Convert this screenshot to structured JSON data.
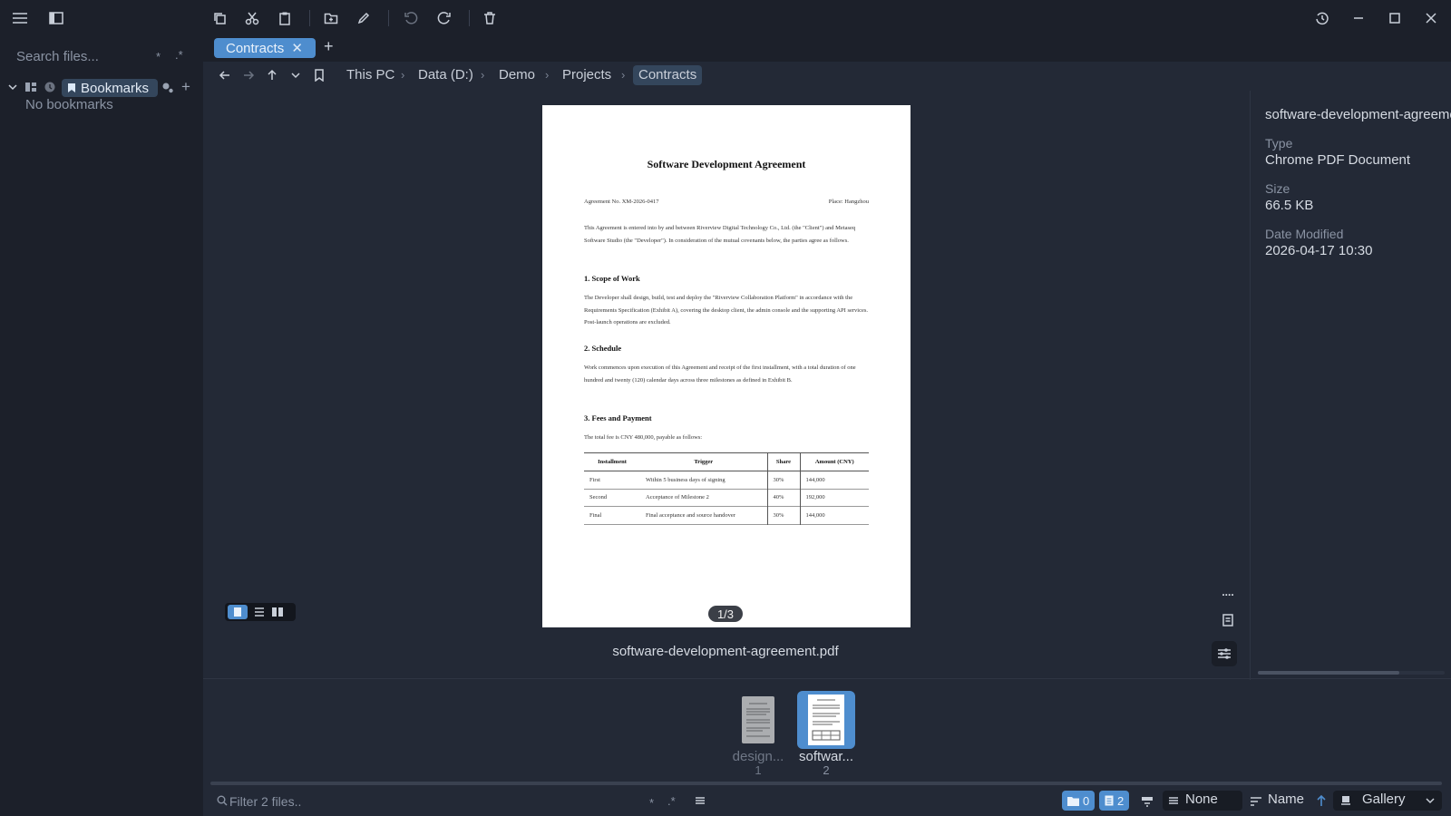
{
  "sidebar": {
    "search_placeholder": "Search files...",
    "search_star": "*",
    "search_regex": ".*",
    "bookmarks_label": "Bookmarks",
    "no_bookmarks": "No bookmarks"
  },
  "tabs": [
    {
      "label": "Contracts",
      "close": "✕"
    }
  ],
  "new_tab": "+",
  "breadcrumb": [
    "This PC",
    "Data (D:)",
    "Demo",
    "Projects",
    "Contracts"
  ],
  "breadcrumb_sep": "›",
  "preview": {
    "page_indicator": "1/3",
    "filename": "software-development-agreement.pdf",
    "more_label": "...."
  },
  "pdf": {
    "title": "Software Development Agreement",
    "agreement_no": "Agreement No. XM-2026-0417",
    "place": "Place: Hangzhou",
    "intro": "This Agreement is entered into by and between Riverview Digital Technology Co., Ltd. (the \"Client\") and Metaseq Software Studio (the \"Developer\"). In consideration of the mutual covenants below, the parties agree as follows.",
    "s1_title": "1. Scope of Work",
    "s1_body": "The Developer shall design, build, test and deploy the \"Riverview Collaboration Platform\" in accordance with the Requirements Specification (Exhibit A), covering the desktop client, the admin console and the supporting API services. Post-launch operations are excluded.",
    "s2_title": "2. Schedule",
    "s2_body": "Work commences upon execution of this Agreement and receipt of the first installment, with a total duration of one hundred and twenty (120) calendar days across three milestones as defined in Exhibit B.",
    "s3_title": "3. Fees and Payment",
    "s3_body": "The total fee is CNY 480,000, payable as follows:",
    "table_headers": [
      "Installment",
      "Trigger",
      "Share",
      "Amount (CNY)"
    ],
    "table_rows": [
      [
        "First",
        "Within 5 business days of signing",
        "30%",
        "144,000"
      ],
      [
        "Second",
        "Acceptance of Milestone 2",
        "40%",
        "192,000"
      ],
      [
        "Final",
        "Final acceptance and source handover",
        "30%",
        "144,000"
      ]
    ]
  },
  "details": {
    "name": "software-development-agreement.pdf",
    "type_label": "Type",
    "type_value": "Chrome PDF Document",
    "size_label": "Size",
    "size_value": "66.5 KB",
    "date_label": "Date Modified",
    "date_value": "2026-04-17 10:30"
  },
  "thumbnails": [
    {
      "label": "design...",
      "index": "1"
    },
    {
      "label": "softwar...",
      "index": "2"
    }
  ],
  "status": {
    "filter_placeholder": "Filter 2 files..",
    "filter_star": "*",
    "filter_regex": ".*",
    "folders_count": "0",
    "files_count": "2",
    "group_value": "None",
    "sort_value": "Name",
    "view_value": "Gallery"
  },
  "colors": {
    "accent": "#4e8dce",
    "background": "#1c202a",
    "panel": "#232936"
  }
}
